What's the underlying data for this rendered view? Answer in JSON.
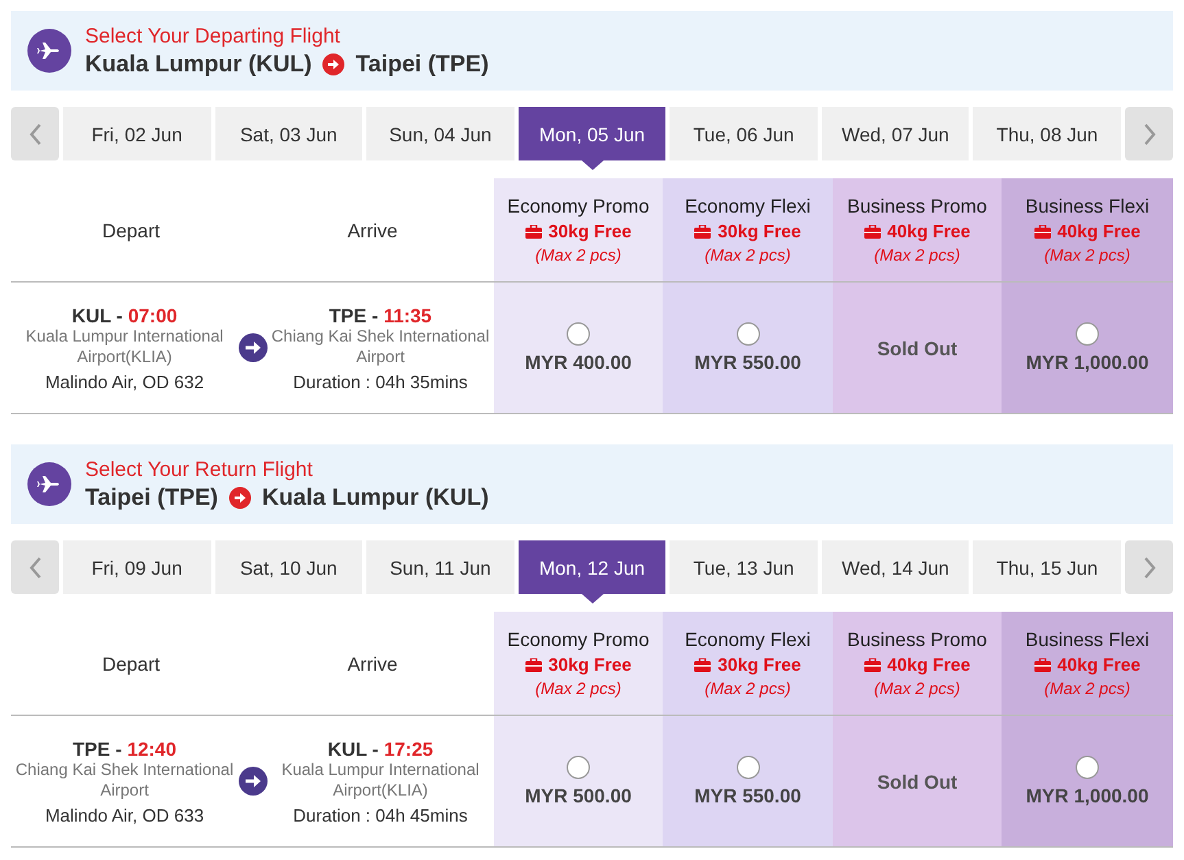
{
  "sections": [
    {
      "title": "Select Your Departing Flight",
      "origin": "Kuala Lumpur (KUL)",
      "destination": "Taipei (TPE)",
      "dates": [
        {
          "label": "Fri, 02 Jun",
          "selected": false
        },
        {
          "label": "Sat, 03 Jun",
          "selected": false
        },
        {
          "label": "Sun, 04 Jun",
          "selected": false
        },
        {
          "label": "Mon, 05 Jun",
          "selected": true
        },
        {
          "label": "Tue, 06 Jun",
          "selected": false
        },
        {
          "label": "Wed, 07 Jun",
          "selected": false
        },
        {
          "label": "Thu, 08 Jun",
          "selected": false
        }
      ],
      "columns": {
        "depart": "Depart",
        "arrive": "Arrive"
      },
      "fares": [
        {
          "name": "Economy Promo",
          "baggage": "30kg Free",
          "limit": "(Max 2 pcs)"
        },
        {
          "name": "Economy Flexi",
          "baggage": "30kg Free",
          "limit": "(Max 2 pcs)"
        },
        {
          "name": "Business Promo",
          "baggage": "40kg Free",
          "limit": "(Max 2 pcs)"
        },
        {
          "name": "Business Flexi",
          "baggage": "40kg Free",
          "limit": "(Max 2 pcs)"
        }
      ],
      "flight": {
        "separator": "-",
        "depart_code": "KUL",
        "depart_time": "07:00",
        "depart_airport": "Kuala Lumpur International Airport(KLIA)",
        "airline": "Malindo Air, OD 632",
        "arrive_code": "TPE",
        "arrive_time": "11:35",
        "arrive_airport": "Chiang Kai Shek International Airport",
        "duration": "Duration : 04h 35mins",
        "prices": [
          {
            "kind": "available",
            "price": "MYR 400.00",
            "selected": false
          },
          {
            "kind": "available",
            "price": "MYR 550.00",
            "selected": false
          },
          {
            "kind": "sold_out",
            "price": "Sold Out"
          },
          {
            "kind": "available",
            "price": "MYR 1,000.00",
            "selected": false
          }
        ]
      }
    },
    {
      "title": "Select Your Return Flight",
      "origin": "Taipei (TPE)",
      "destination": "Kuala Lumpur (KUL)",
      "dates": [
        {
          "label": "Fri, 09 Jun",
          "selected": false
        },
        {
          "label": "Sat, 10 Jun",
          "selected": false
        },
        {
          "label": "Sun, 11 Jun",
          "selected": false
        },
        {
          "label": "Mon, 12 Jun",
          "selected": true
        },
        {
          "label": "Tue, 13 Jun",
          "selected": false
        },
        {
          "label": "Wed, 14 Jun",
          "selected": false
        },
        {
          "label": "Thu, 15 Jun",
          "selected": false
        }
      ],
      "columns": {
        "depart": "Depart",
        "arrive": "Arrive"
      },
      "fares": [
        {
          "name": "Economy Promo",
          "baggage": "30kg Free",
          "limit": "(Max 2 pcs)"
        },
        {
          "name": "Economy Flexi",
          "baggage": "30kg Free",
          "limit": "(Max 2 pcs)"
        },
        {
          "name": "Business Promo",
          "baggage": "40kg Free",
          "limit": "(Max 2 pcs)"
        },
        {
          "name": "Business Flexi",
          "baggage": "40kg Free",
          "limit": "(Max 2 pcs)"
        }
      ],
      "flight": {
        "separator": "-",
        "depart_code": "TPE",
        "depart_time": "12:40",
        "depart_airport": "Chiang Kai Shek International Airport",
        "airline": "Malindo Air, OD 633",
        "arrive_code": "KUL",
        "arrive_time": "17:25",
        "arrive_airport": "Kuala Lumpur International Airport(KLIA)",
        "duration": "Duration : 04h 45mins",
        "prices": [
          {
            "kind": "available",
            "price": "MYR 500.00",
            "selected": false
          },
          {
            "kind": "available",
            "price": "MYR 550.00",
            "selected": false
          },
          {
            "kind": "sold_out",
            "price": "Sold Out"
          },
          {
            "kind": "available",
            "price": "MYR 1,000.00",
            "selected": false
          }
        ]
      }
    }
  ]
}
